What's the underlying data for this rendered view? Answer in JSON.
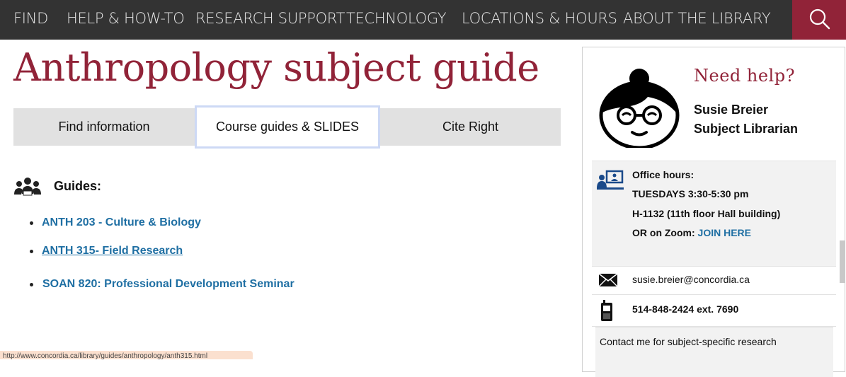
{
  "nav": {
    "items": [
      "FIND",
      "HELP & HOW-TO",
      "RESEARCH SUPPORT",
      "TECHNOLOGY",
      "LOCATIONS & HOURS",
      "ABOUT THE LIBRARY"
    ],
    "search_icon": "search-icon",
    "background": "#333333",
    "accent": "#912338"
  },
  "page": {
    "title": "Anthropology subject guide"
  },
  "tabs": [
    {
      "label": "Find information",
      "active": false
    },
    {
      "label": "Course guides & SLIDES",
      "active": true
    },
    {
      "label": "Cite Right",
      "active": false
    }
  ],
  "guides": {
    "heading": "Guides:",
    "icon": "group-icon",
    "items": [
      "ANTH 203 - Culture & Biology",
      "ANTH 315- Field Research",
      "SOAN 820: Professional Development Seminar"
    ]
  },
  "status_url": "http://www.concordia.ca/library/guides/anthropology/anth315.html",
  "sidebar": {
    "help_title": "Need help?",
    "librarian_name": "Susie Breier",
    "librarian_role": "Subject Librarian",
    "office_hours_label": "Office hours:",
    "office_hours_time": "TUESDAYS 3:30-5:30 pm",
    "office_hours_location": "H-1132  (11th floor Hall building)",
    "zoom_prefix": "OR on Zoom:",
    "zoom_link": "JOIN HERE",
    "email": "susie.breier@concordia.ca",
    "phone": "514-848-2424 ext. 7690",
    "contact_note": "Contact me for subject-specific research"
  },
  "colors": {
    "link": "#1f6fa3",
    "brand": "#912338"
  }
}
